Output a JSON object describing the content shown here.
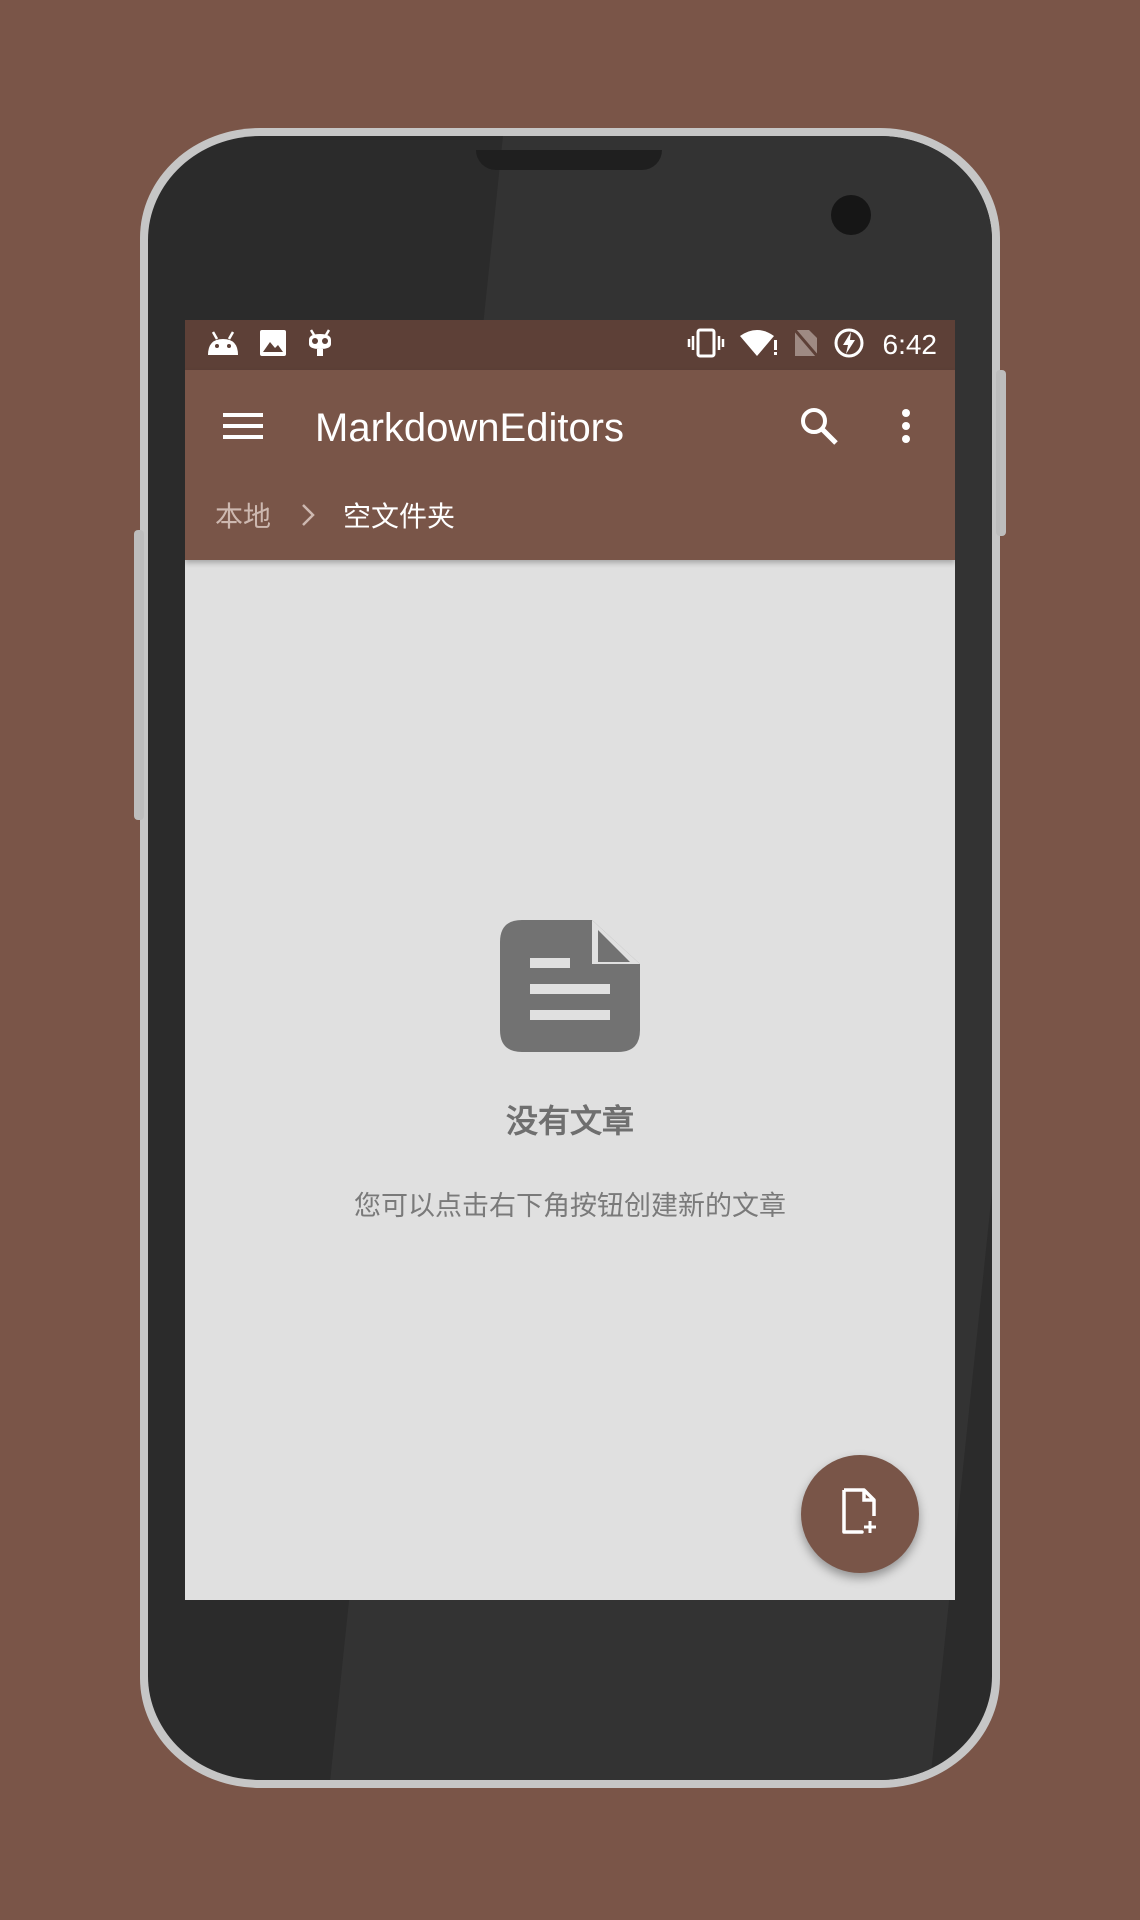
{
  "status_bar": {
    "time": "6:42",
    "left_icons": [
      "android-icon",
      "image-icon",
      "cyanogen-icon"
    ],
    "right_icons": [
      "vibrate-icon",
      "wifi-icon",
      "no-sim-icon",
      "battery-charging-icon"
    ]
  },
  "toolbar": {
    "title": "MarkdownEditors",
    "menu_icon": "hamburger-menu-icon",
    "search_icon": "search-icon",
    "more_icon": "more-vert-icon"
  },
  "breadcrumb": {
    "root": "本地",
    "separator_icon": "chevron-right-icon",
    "current": "空文件夹"
  },
  "empty_state": {
    "icon": "document-icon",
    "title": "没有文章",
    "subtitle": "您可以点击右下角按钮创建新的文章"
  },
  "fab": {
    "icon": "new-file-icon"
  },
  "colors": {
    "background": "#7a5548",
    "primary": "#795548",
    "primary_dark": "#5d4037",
    "content_background": "#e0e0e0",
    "empty_text": "#6f6f6f"
  }
}
